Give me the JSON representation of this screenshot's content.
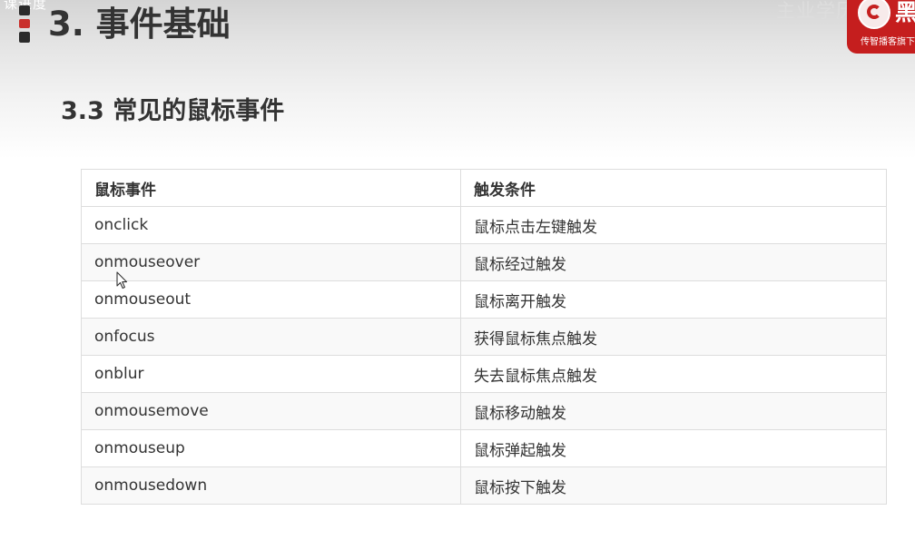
{
  "slide": {
    "top_label": "课进度",
    "title": "3. 事件基础",
    "section_title": "3.3 常见的鼠标事件"
  },
  "brand": {
    "watermark": "主业学历资",
    "logo_char": "黑",
    "slogan": "传智播客旗下"
  },
  "table": {
    "headers": [
      "鼠标事件",
      "触发条件"
    ],
    "rows": [
      [
        "onclick",
        "鼠标点击左键触发"
      ],
      [
        "onmouseover",
        "鼠标经过触发"
      ],
      [
        "onmouseout",
        "鼠标离开触发"
      ],
      [
        "onfocus",
        "获得鼠标焦点触发"
      ],
      [
        "onblur",
        "失去鼠标焦点触发"
      ],
      [
        "onmousemove",
        "鼠标移动触发"
      ],
      [
        "onmouseup",
        "鼠标弹起触发"
      ],
      [
        "onmousedown",
        "鼠标按下触发"
      ]
    ]
  },
  "colors": {
    "accent_red": "#c51e1e",
    "marker_dark": "#2b2b2b",
    "text": "#333333",
    "table_border": "#dddddd"
  },
  "icons": {
    "cursor": "arrow-cursor-icon",
    "logo": "brand-logo-icon"
  }
}
